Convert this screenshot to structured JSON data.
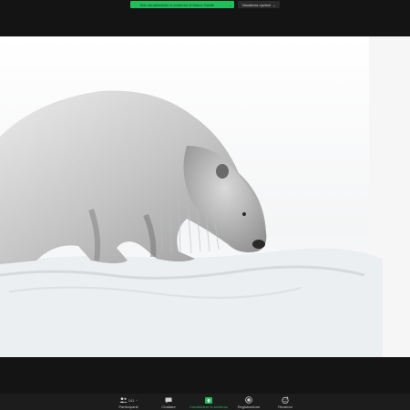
{
  "banner": {
    "share_status": "Stai visualizzando lo schermo di Marco Gavitti",
    "share_chevron": "⌄",
    "view_options": "Visualizza opzioni",
    "view_chevron": "⌄"
  },
  "shared_content": {
    "description_icon": "polar-bear-photo"
  },
  "toolbar": {
    "participants": {
      "label": "Partecipanti",
      "count": "141",
      "icon": "participants-icon"
    },
    "chat": {
      "label": "Chattare",
      "icon": "chat-icon"
    },
    "share": {
      "label": "Condividere lo schermo",
      "icon": "share-screen-icon"
    },
    "record": {
      "label": "Registrazione",
      "icon": "record-icon"
    },
    "reactions": {
      "label": "Reazioni",
      "icon": "reactions-icon"
    }
  },
  "colors": {
    "background": "#141414",
    "share_green": "#1fc05a",
    "toolbar": "#1c1c1c"
  }
}
